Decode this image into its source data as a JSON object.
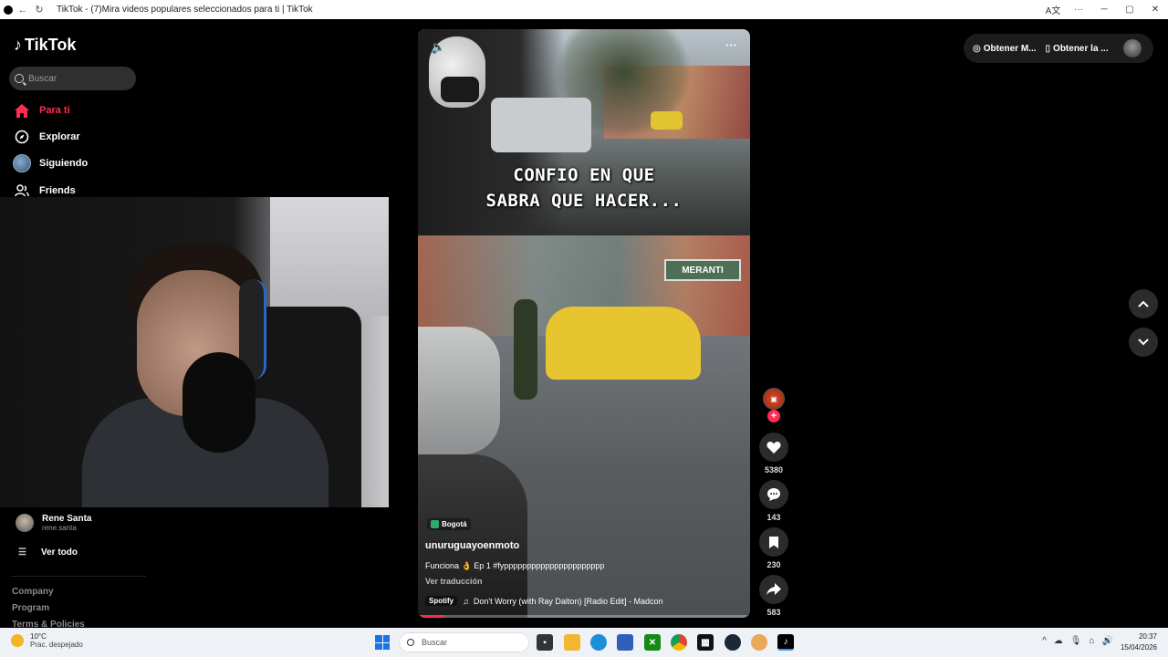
{
  "browser": {
    "title": "TikTok - (7)Mira videos populares seleccionados para ti | TikTok"
  },
  "sidebar": {
    "logo": "TikTok",
    "search_placeholder": "Buscar",
    "nav": [
      {
        "label": "Para ti",
        "icon": "home-icon",
        "active": true
      },
      {
        "label": "Explorar",
        "icon": "compass-icon"
      },
      {
        "label": "Siguiendo",
        "icon": "globe-avatar-icon"
      },
      {
        "label": "Friends",
        "icon": "people-icon"
      }
    ],
    "following": {
      "name": "Rene Santa",
      "handle": "rene.santa"
    },
    "see_all": "Ver todo",
    "footer_links": [
      "Company",
      "Program",
      "Terms & Policies"
    ]
  },
  "video": {
    "caption_line1": "CONFIO EN QUE",
    "caption_line2": "SABRA QUE HACER...",
    "storefront_sign": "MERANTI",
    "location": "Bogotá",
    "author": "unuruguayoenmoto",
    "description": "Funciona 👌 Ep 1 #fypppppppppppppppppppppp",
    "translate": "Ver traducción",
    "music_source": "Spotify",
    "music_title": "Don't Worry (with Ray Dalton) [Radio Edit] - Madcon",
    "progress": 0.08
  },
  "actions": {
    "likes": "5380",
    "comments": "143",
    "saves": "230",
    "shares": "583"
  },
  "topbar": {
    "get_coins": "Obtener M...",
    "get_app": "Obtener la ..."
  },
  "taskbar": {
    "temperature": "10°C",
    "weather": "Prac. despejado",
    "search_placeholder": "Buscar",
    "time": "20:37",
    "date": "15/04/2026"
  },
  "colors": {
    "accent": "#fe2c55",
    "background": "#000000",
    "taskbar": "#eef1f6"
  }
}
